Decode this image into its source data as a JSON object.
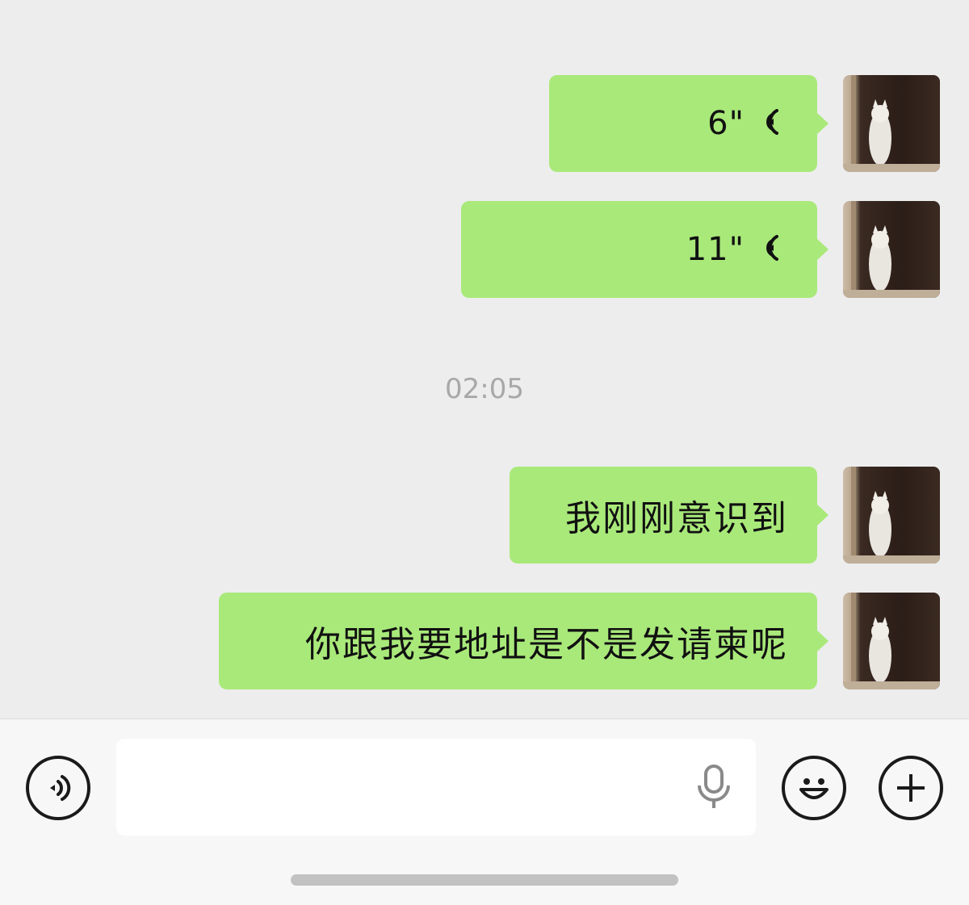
{
  "messages": [
    {
      "type": "voice",
      "duration": "6\""
    },
    {
      "type": "voice",
      "duration": "11\""
    },
    {
      "type": "text",
      "text": "我刚刚意识到"
    },
    {
      "type": "text",
      "text": "你跟我要地址是不是发请柬呢"
    }
  ],
  "timestamp": "02:05",
  "input": {
    "placeholder": ""
  },
  "icons": {
    "voice_toggle": "voice-mode-icon",
    "microphone": "microphone-icon",
    "emoji": "emoji-icon",
    "more": "plus-icon",
    "voice_wave": "voice-wave-icon"
  },
  "colors": {
    "bubble": "#a9e97a",
    "background": "#ededed"
  }
}
